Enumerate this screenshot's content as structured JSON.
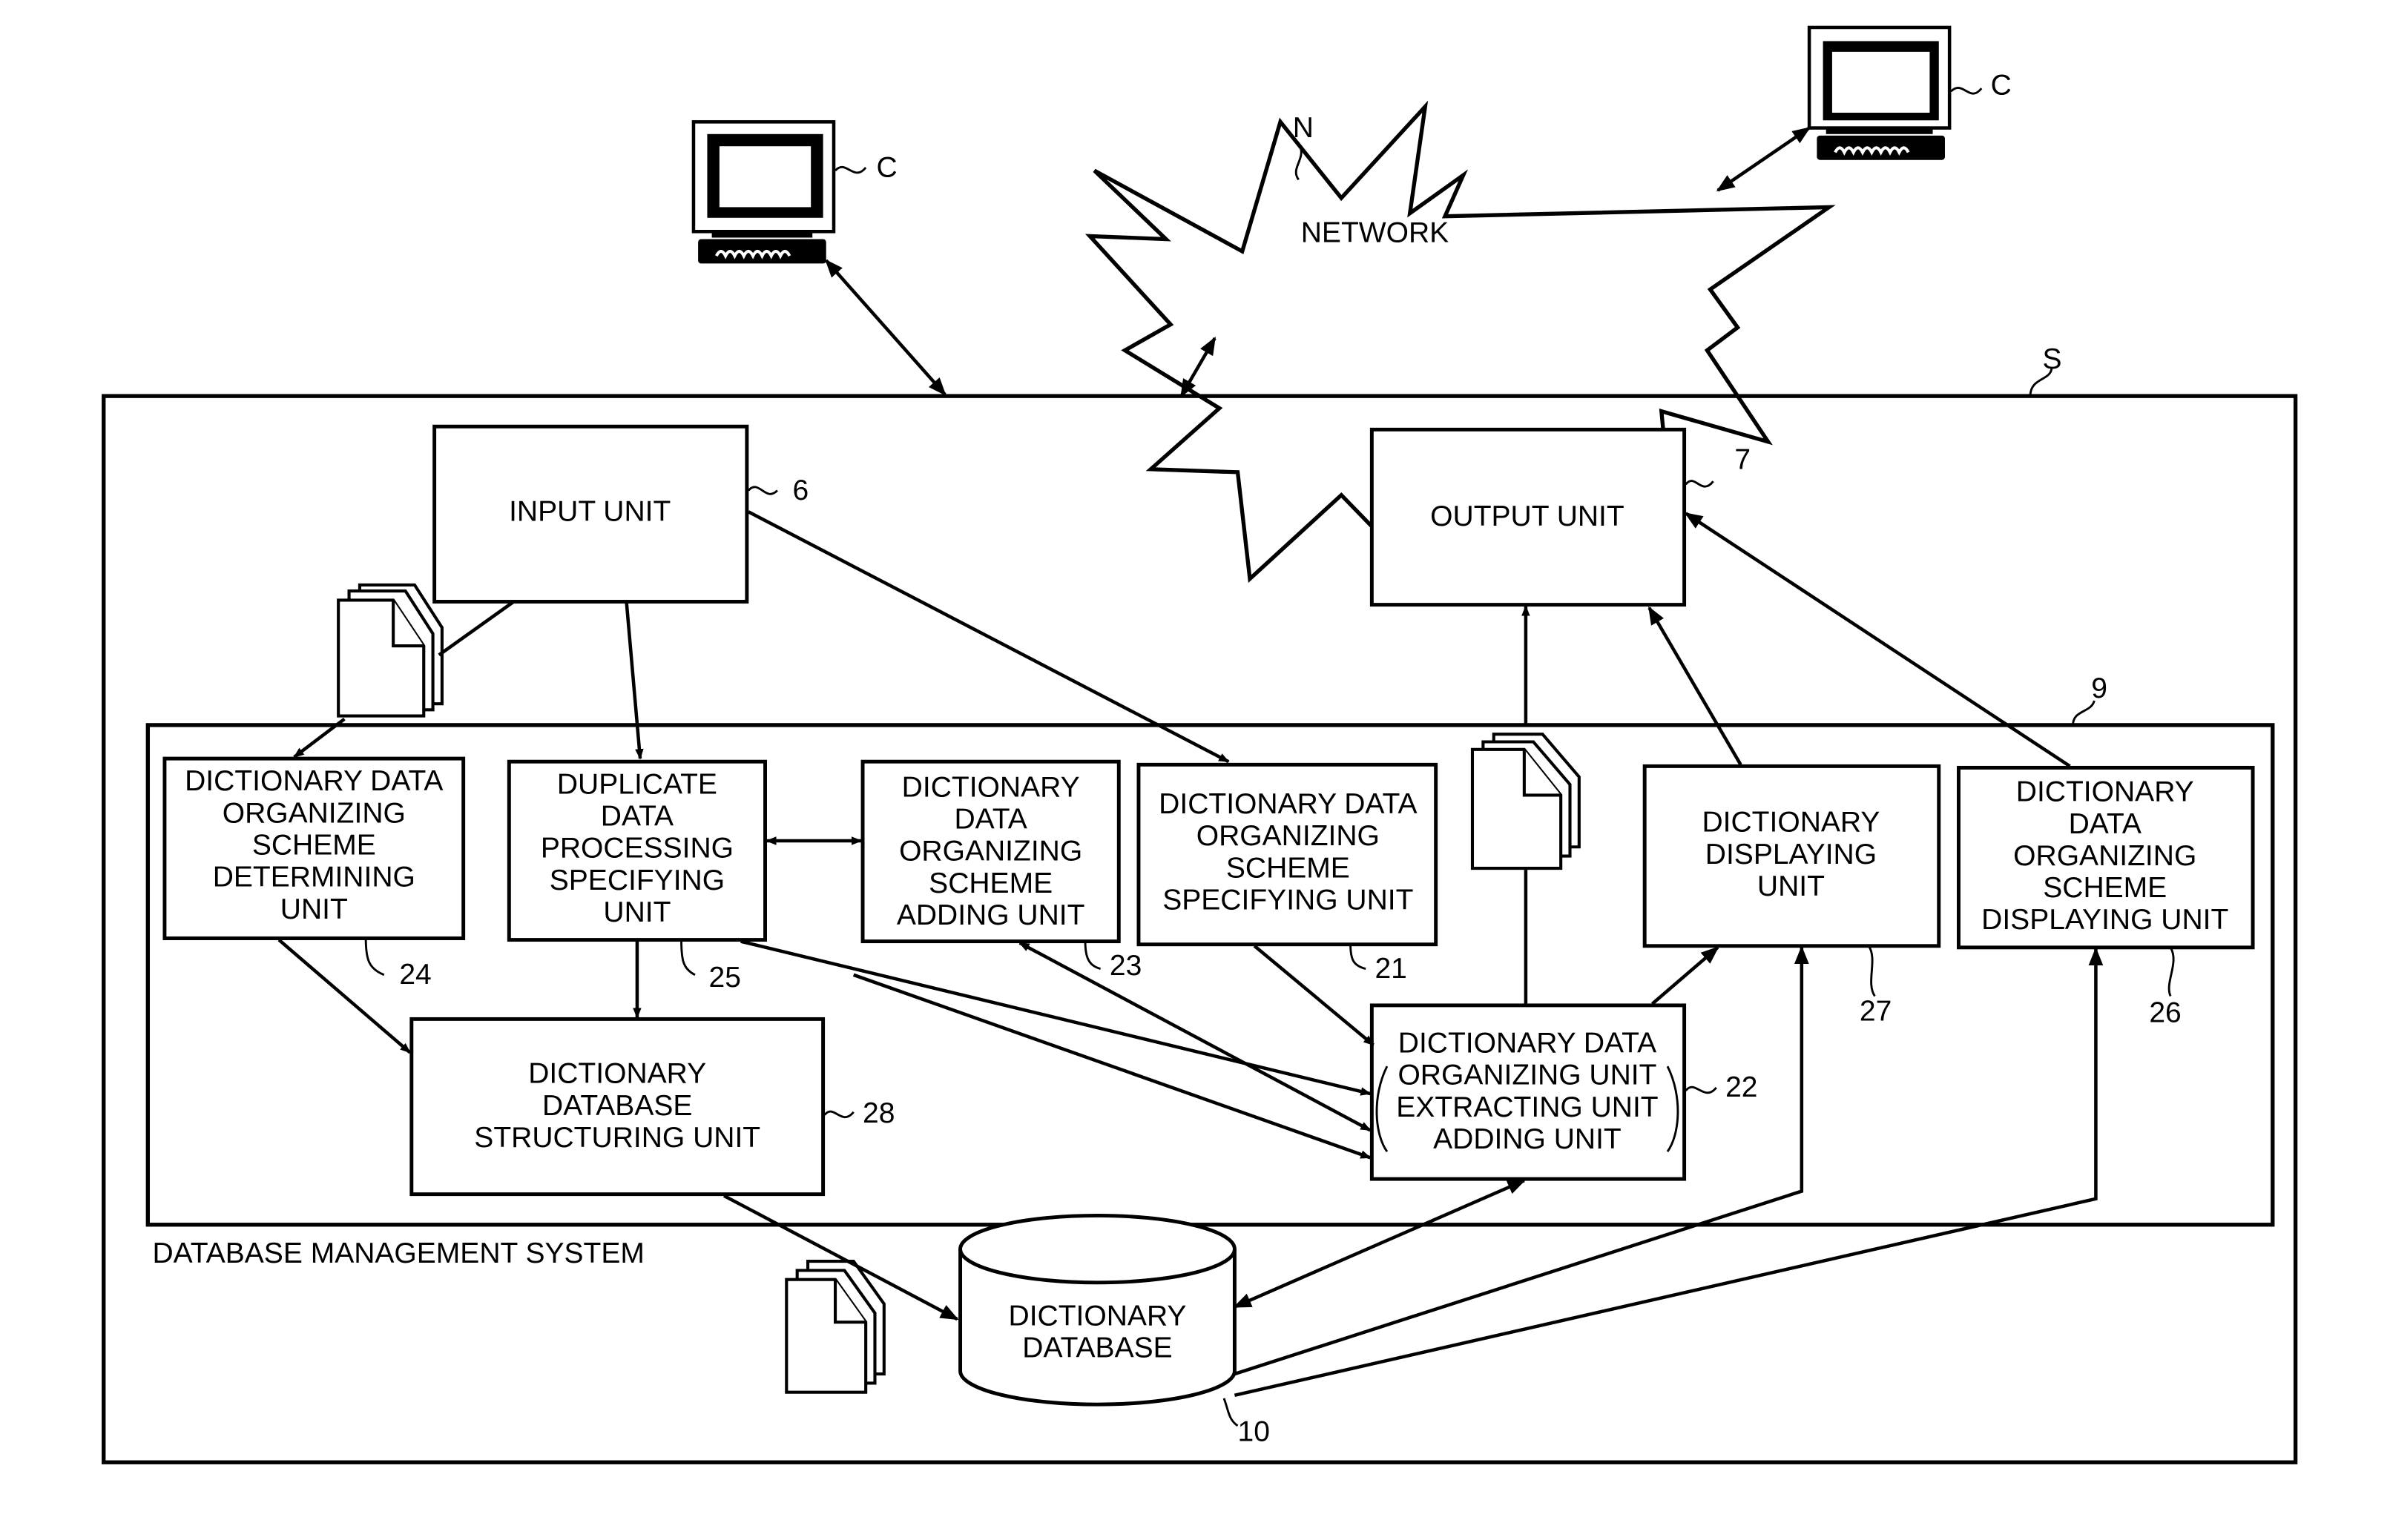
{
  "network": {
    "label": "NETWORK",
    "ref": "N"
  },
  "terminals": [
    {
      "ref": "C",
      "position": "left"
    },
    {
      "ref": "C",
      "position": "right"
    }
  ],
  "server": {
    "ref": "S"
  },
  "dbms": {
    "label": "DATABASE MANAGEMENT SYSTEM",
    "ref": "9"
  },
  "units": {
    "input": {
      "lines": [
        "INPUT UNIT"
      ],
      "ref": "6"
    },
    "output": {
      "lines": [
        "OUTPUT UNIT"
      ],
      "ref": "7"
    },
    "scheme_determining": {
      "lines": [
        "DICTIONARY DATA",
        "ORGANIZING",
        "SCHEME",
        "DETERMINING",
        "UNIT"
      ],
      "ref": "24"
    },
    "duplicate_processing": {
      "lines": [
        "DUPLICATE",
        "DATA",
        "PROCESSING",
        "SPECIFYING",
        "UNIT"
      ],
      "ref": "25"
    },
    "scheme_adding": {
      "lines": [
        "DICTIONARY",
        "DATA",
        "ORGANIZING",
        "SCHEME",
        "ADDING UNIT"
      ],
      "ref": "23"
    },
    "scheme_specifying": {
      "lines": [
        "DICTIONARY DATA",
        "ORGANIZING",
        "SCHEME",
        "SPECIFYING UNIT"
      ],
      "ref": "21"
    },
    "dictionary_displaying": {
      "lines": [
        "DICTIONARY",
        "DISPLAYING",
        "UNIT"
      ],
      "ref": "27"
    },
    "scheme_displaying": {
      "lines": [
        "DICTIONARY",
        "DATA",
        "ORGANIZING",
        "SCHEME",
        "DISPLAYING UNIT"
      ],
      "ref": "26"
    },
    "organizing": {
      "lines": [
        "DICTIONARY DATA",
        "ORGANIZING UNIT",
        "EXTRACTING UNIT",
        "ADDING UNIT"
      ],
      "ref": "22"
    },
    "structuring": {
      "lines": [
        "DICTIONARY",
        "DATABASE",
        "STRUCTURING UNIT"
      ],
      "ref": "28"
    }
  },
  "database": {
    "lines": [
      "DICTIONARY",
      "DATABASE"
    ],
    "ref": "10"
  }
}
